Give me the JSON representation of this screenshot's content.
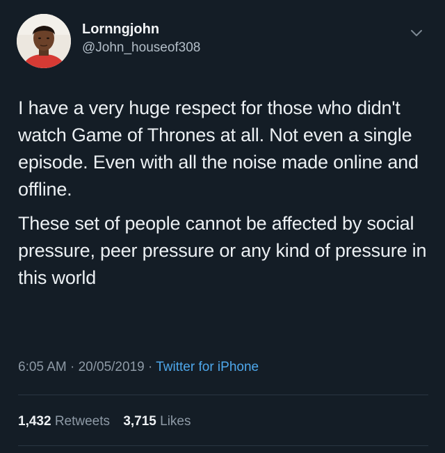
{
  "tweet": {
    "author": {
      "display_name": "Lornngjohn",
      "handle": "@John_houseof308",
      "avatar_icon": "profile-photo"
    },
    "menu_icon": "chevron-down-icon",
    "paragraphs": [
      "I have a very huge respect for those who didn't watch Game of Thrones at all. Not even a single episode. Even with all the noise made online and offline.",
      "These set of people cannot be affected by social pressure, peer pressure or any kind of pressure in this world"
    ],
    "meta": {
      "time": "6:05 AM",
      "separator": "·",
      "date": "20/05/2019",
      "source": "Twitter for iPhone"
    },
    "stats": {
      "retweets_count": "1,432",
      "retweets_label": "Retweets",
      "likes_count": "3,715",
      "likes_label": "Likes"
    },
    "colors": {
      "background": "#141d26",
      "link": "#4ea8ec",
      "muted": "#8e9aa6"
    }
  }
}
